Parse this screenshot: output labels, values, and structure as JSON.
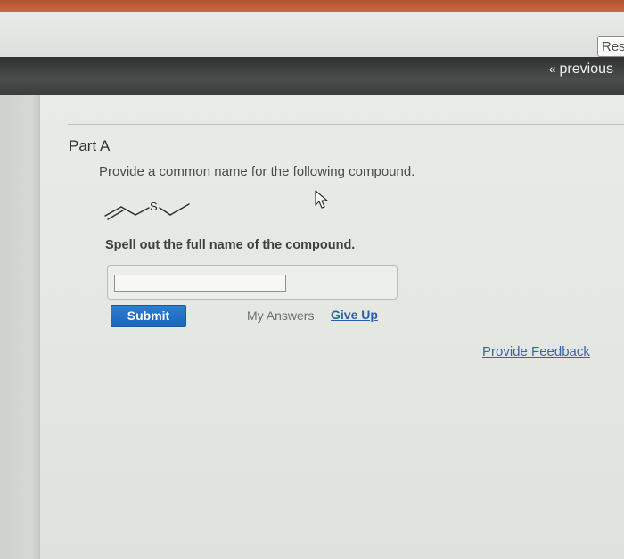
{
  "topbar": {
    "reset_label": "Res"
  },
  "navbar": {
    "previous_chevron": "«",
    "previous_label": "previous"
  },
  "problem": {
    "part_title": "Part A",
    "question": "Provide a common name for the following compound.",
    "structure_atom": "S",
    "instruction": "Spell out the full name of the compound.",
    "answer_value": "",
    "answer_placeholder": ""
  },
  "actions": {
    "submit_label": "Submit",
    "my_answers_label": "My Answers",
    "give_up_label": "Give Up"
  },
  "footer": {
    "feedback_label": "Provide Feedback"
  },
  "colors": {
    "submit_blue": "#1f6fc7",
    "link_blue": "#2a5fae",
    "nav_dark": "#3b3d3d"
  }
}
